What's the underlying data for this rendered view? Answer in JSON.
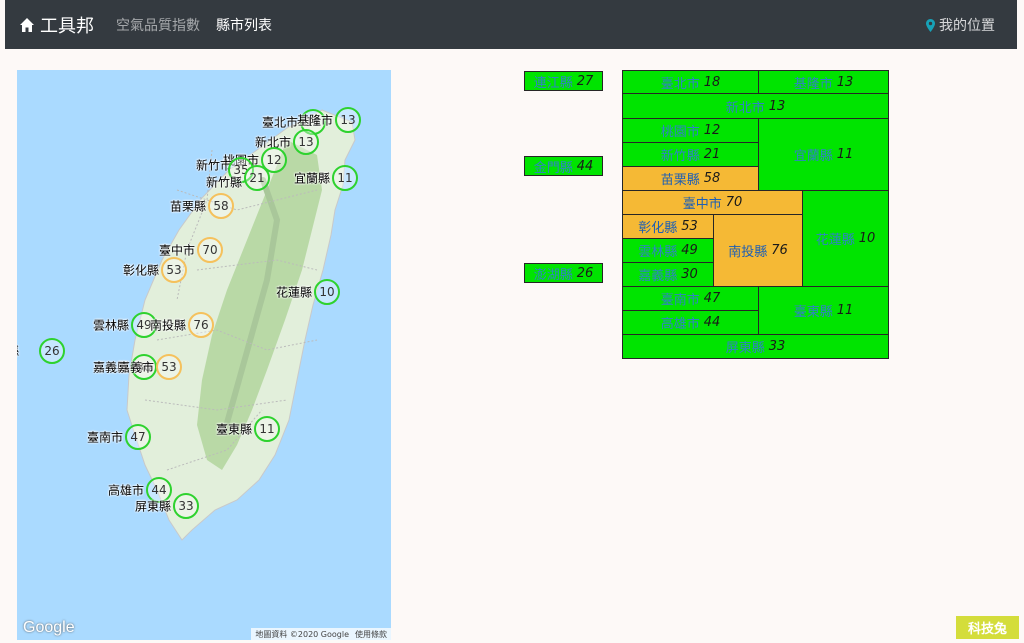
{
  "nav": {
    "brand": "工具邦",
    "links": [
      "空氣品質指數",
      "縣市列表"
    ],
    "location": "我的位置"
  },
  "map": {
    "markers": [
      {
        "name": "臺北市",
        "aqi": "18",
        "level": "green"
      },
      {
        "name": "基隆市",
        "aqi": "13",
        "level": "green"
      },
      {
        "name": "新北市",
        "aqi": "13",
        "level": "green"
      },
      {
        "name": "桃園市",
        "aqi": "12",
        "level": "green"
      },
      {
        "name": "新竹市",
        "aqi": "35",
        "level": "green"
      },
      {
        "name": "新竹縣",
        "aqi": "21",
        "level": "green"
      },
      {
        "name": "宜蘭縣",
        "aqi": "11",
        "level": "green"
      },
      {
        "name": "苗栗縣",
        "aqi": "58",
        "level": "orange"
      },
      {
        "name": "臺中市",
        "aqi": "70",
        "level": "orange"
      },
      {
        "name": "彰化縣",
        "aqi": "53",
        "level": "orange"
      },
      {
        "name": "花蓮縣",
        "aqi": "10",
        "level": "green"
      },
      {
        "name": "雲林縣",
        "aqi": "49",
        "level": "green"
      },
      {
        "name": "南投縣",
        "aqi": "76",
        "level": "orange"
      },
      {
        "name": "澎湖縣",
        "aqi": "26",
        "level": "green"
      },
      {
        "name": "嘉義縣",
        "aqi": "30",
        "level": "green"
      },
      {
        "name": "嘉義市",
        "aqi": "53",
        "level": "orange"
      },
      {
        "name": "臺南市",
        "aqi": "47",
        "level": "green"
      },
      {
        "name": "臺東縣",
        "aqi": "11",
        "level": "green"
      },
      {
        "name": "高雄市",
        "aqi": "44",
        "level": "green"
      },
      {
        "name": "屏東縣",
        "aqi": "33",
        "level": "green"
      }
    ],
    "google": "Google",
    "attribution": "地圖資料 ©2020 Google",
    "terms": "使用條款"
  },
  "treemap": [
    {
      "name": "連江縣",
      "value": "27",
      "level": "green"
    },
    {
      "name": "金門縣",
      "value": "44",
      "level": "green"
    },
    {
      "name": "澎湖縣",
      "value": "26",
      "level": "green"
    },
    {
      "name": "臺北市",
      "value": "18",
      "level": "green"
    },
    {
      "name": "基隆市",
      "value": "13",
      "level": "green"
    },
    {
      "name": "新北市",
      "value": "13",
      "level": "green"
    },
    {
      "name": "桃園市",
      "value": "12",
      "level": "green"
    },
    {
      "name": "新竹縣",
      "value": "21",
      "level": "green"
    },
    {
      "name": "苗栗縣",
      "value": "58",
      "level": "yellow"
    },
    {
      "name": "宜蘭縣",
      "value": "11",
      "level": "green"
    },
    {
      "name": "臺中市",
      "value": "70",
      "level": "yellow"
    },
    {
      "name": "彰化縣",
      "value": "53",
      "level": "yellow"
    },
    {
      "name": "雲林縣",
      "value": "49",
      "level": "green"
    },
    {
      "name": "嘉義縣",
      "value": "30",
      "level": "green"
    },
    {
      "name": "南投縣",
      "value": "76",
      "level": "yellow"
    },
    {
      "name": "花蓮縣",
      "value": "10",
      "level": "green"
    },
    {
      "name": "臺南市",
      "value": "47",
      "level": "green"
    },
    {
      "name": "高雄市",
      "value": "44",
      "level": "green"
    },
    {
      "name": "臺東縣",
      "value": "11",
      "level": "green"
    },
    {
      "name": "屏東縣",
      "value": "33",
      "level": "green"
    }
  ],
  "watermark": "科技兔",
  "colors": {
    "good": "#00e400",
    "moderate": "#f5b935",
    "navbar": "#343a40"
  }
}
